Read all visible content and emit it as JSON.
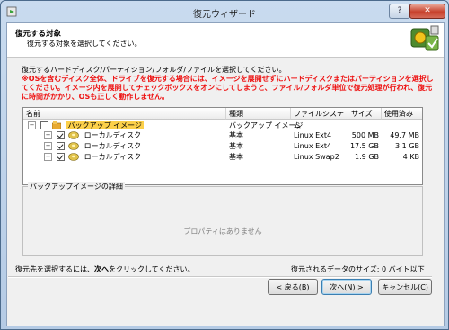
{
  "window": {
    "title": "復元ウィザード",
    "help_label": "?",
    "close_label": "✕"
  },
  "header": {
    "title": "復元する対象",
    "subtitle": "復元する対象を選択してください。"
  },
  "instructions": {
    "line1": "復元するハードディスク/パーティション/フォルダ/ファイルを選択してください。",
    "warning": "※OSを含むディスク全体、ドライブを復元する場合には、イメージを展開せずにハードディスクまたはパーティションを選択してください。イメージ内を展開してチェックボックスをオンにしてしまうと、ファイル/フォルダ単位で復元処理が行われ、復元に時間がかかり、OSも正しく動作しません。"
  },
  "tree": {
    "columns": [
      "名前",
      "種類",
      "ファイルシステム",
      "サイズ",
      "使用済み"
    ],
    "rows": [
      {
        "name": "バックアップ イメージ",
        "type": "バックアップ イメージ",
        "fs": "",
        "size": "",
        "used": ""
      },
      {
        "name": "ローカルディスク",
        "type": "基本",
        "fs": "Linux Ext4",
        "size": "500 MB",
        "used": "49.7 MB"
      },
      {
        "name": "ローカルディスク",
        "type": "基本",
        "fs": "Linux Ext4",
        "size": "17.5 GB",
        "used": "3.1 GB"
      },
      {
        "name": "ローカルディスク",
        "type": "基本",
        "fs": "Linux Swap2",
        "size": "1.9 GB",
        "used": "4 KB"
      }
    ]
  },
  "details": {
    "label": "バックアップイメージの詳細",
    "empty": "プロパティはありません"
  },
  "status": {
    "left_pre": "復元先を選択するには、",
    "left_bold": "次へ",
    "left_post": "をクリックしてください。",
    "right": "復元されるデータのサイズ: 0 バイト以下"
  },
  "buttons": {
    "back": "< 戻る(B)",
    "next": "次へ(N) >",
    "cancel": "キャンセル(C)"
  },
  "colors": {
    "warning": "#ee1111",
    "selection": "#fcd04a",
    "title_gradient_top": "#c9dbef"
  }
}
